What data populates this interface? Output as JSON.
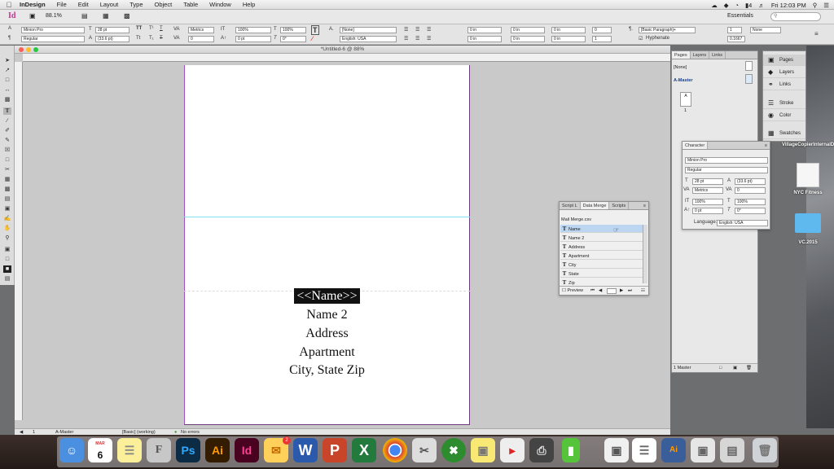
{
  "menubar": {
    "app_name": "InDesign",
    "items": [
      "File",
      "Edit",
      "Layout",
      "Type",
      "Object",
      "Table",
      "Window",
      "Help"
    ],
    "clock": "Fri 12:03 PM",
    "battery_count": "4"
  },
  "appbar": {
    "logo": "Id",
    "zoom": "88.1%",
    "workspace": "Essentials",
    "search_placeholder": ""
  },
  "control": {
    "font_family": "Minion Pro",
    "font_style": "Regular",
    "font_size": "28 pt",
    "leading": "(33.6 pt)",
    "kerning": "Metrics",
    "tracking": "0",
    "vscale": "100%",
    "hscale": "100%",
    "baseline": "0 pt",
    "skew": "0°",
    "char_style": "[None]",
    "language": "English: USA",
    "para_style": "[Basic Paragraph]+",
    "hyphenate_label": "Hyphenate",
    "indent_values": [
      "0 in",
      "0 in",
      "0 in",
      "0 in",
      "0 in",
      "0 in"
    ],
    "drop_cap_lines": "0",
    "drop_cap_chars": "1",
    "columns_value": "None",
    "gutter": "0.1667"
  },
  "document": {
    "title": "*Untitled-6 @ 88%",
    "lines": {
      "name": "<<Name>>",
      "name2": "Name 2",
      "address": "Address",
      "apartment": "Apartment",
      "city": "City, State Zip"
    }
  },
  "status": {
    "page": "1",
    "master": "A-Master",
    "style": "[Basic] (working)",
    "errors": "No errors"
  },
  "data_merge": {
    "tabs": [
      "Script L",
      "Data Merge",
      "Scripts"
    ],
    "source": "Mail Merge.csv",
    "fields": [
      "Name",
      "Name 2",
      "Address",
      "Apartment",
      "City",
      "State",
      "Zip"
    ],
    "selected_index": 0,
    "preview_label": "Preview"
  },
  "pages_panel": {
    "tabs": [
      "Pages",
      "Layers",
      "Links"
    ],
    "none_label": "[None]",
    "master_label": "A-Master",
    "page_number": "1",
    "footer": "1 Master"
  },
  "dock_panels": [
    {
      "label": "Pages",
      "icon": "pages-icon"
    },
    {
      "label": "Layers",
      "icon": "layers-icon"
    },
    {
      "label": "Links",
      "icon": "links-icon"
    },
    {
      "label": "Stroke",
      "icon": "stroke-icon"
    },
    {
      "label": "Color",
      "icon": "color-icon"
    },
    {
      "label": "Swatches",
      "icon": "swatches-icon"
    }
  ],
  "character_panel": {
    "title": "Character",
    "font_family": "Minion Pro",
    "font_style": "Regular",
    "size": "28 pt",
    "leading": "(33.6 pt)",
    "kerning": "Metrics",
    "tracking": "0",
    "vscale": "100%",
    "hscale": "100%",
    "baseline": "0 pt",
    "skew": "0°",
    "language_label": "Language:",
    "language": "English: USA"
  },
  "desktop": {
    "items": [
      "VillageCopierInternalDesign",
      "NYC Fitness",
      "VC.2015"
    ]
  },
  "dock": {
    "mail_badge": "2",
    "calendar_month": "MAR",
    "calendar_day": "6",
    "apps": [
      "Finder",
      "Calendar",
      "Notes",
      "Font",
      "Ps",
      "Ai",
      "Id",
      "Mail",
      "W",
      "P",
      "X",
      "Chrome",
      "Scissors",
      "Xbox",
      "Stickies",
      "Acrobat",
      "Printer",
      "Phone",
      "Preview",
      "Doc",
      "Ai file",
      "Display",
      "Trash"
    ]
  },
  "colors": {
    "indesign_pink": "#c9308f",
    "guide_cyan": "#7fe3ef",
    "selection_blue": "#bcd6f2",
    "page_border_purple": "#6a3d7a"
  }
}
